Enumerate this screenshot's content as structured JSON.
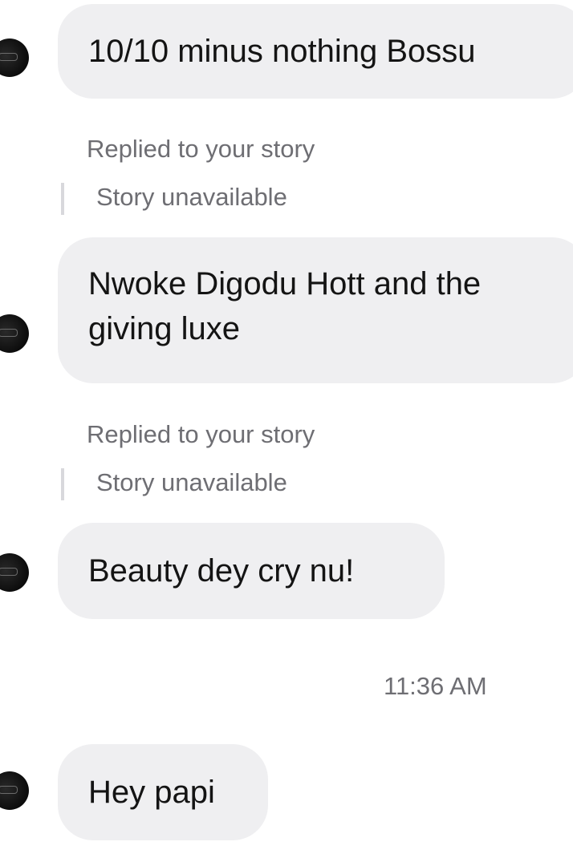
{
  "messages": [
    {
      "text": "10/10 minus nothing Bossu"
    },
    {
      "reply_label": "Replied to your story",
      "story": "Story unavailable",
      "lines": [
        "Nwoke Digodu Hott and the",
        "giving luxe"
      ]
    },
    {
      "reply_label": "Replied to your story",
      "story": "Story unavailable",
      "text": "Beauty dey cry nu!"
    },
    {
      "text": "Hey papi"
    }
  ],
  "timestamp": "11:36 AM",
  "colors": {
    "bubble_bg": "#efeff1",
    "meta_text": "#6e6e73",
    "avatar": "#0c0c0c"
  },
  "icons": {
    "avatar": "sender-avatar"
  }
}
